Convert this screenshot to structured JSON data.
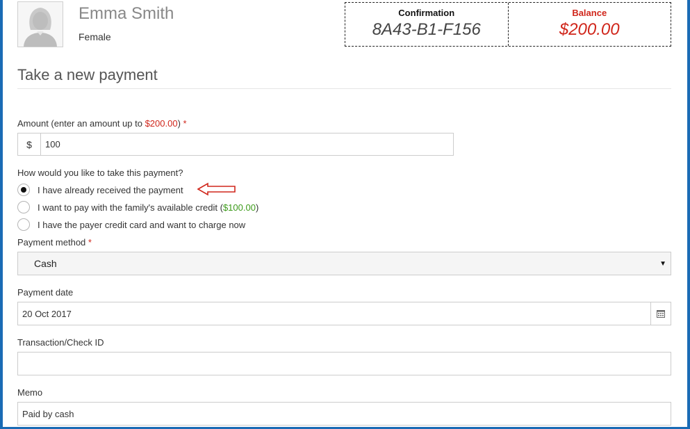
{
  "person": {
    "name": "Emma Smith",
    "gender": "Female",
    "avatar_icon": "female-avatar-icon"
  },
  "summary": {
    "confirmation_label": "Confirmation",
    "confirmation_value": "8A43-B1-F156",
    "balance_label": "Balance",
    "balance_value": "$200.00"
  },
  "section_title": "Take a new payment",
  "amount": {
    "label_prefix": "Amount (enter an amount up to ",
    "label_limit": "$200.00",
    "label_suffix": ")",
    "required_mark": "*",
    "currency_symbol": "$",
    "value": "100"
  },
  "payment_question": "How would you like to take this payment?",
  "payment_options": [
    {
      "label": "I have already received the payment",
      "checked": true
    },
    {
      "label_prefix": "I want to pay with the family's available credit (",
      "credit": "$100.00",
      "label_suffix": ")",
      "checked": false
    },
    {
      "label": "I have the payer credit card and want to charge now",
      "checked": false
    }
  ],
  "payment_method": {
    "label": "Payment method",
    "required_mark": "*",
    "selected": "Cash"
  },
  "payment_date": {
    "label": "Payment date",
    "value": "20 Oct 2017",
    "icon": "calendar-icon"
  },
  "transaction_id": {
    "label": "Transaction/Check ID",
    "value": ""
  },
  "memo": {
    "label": "Memo",
    "value": "Paid by cash"
  },
  "colors": {
    "frame": "#1a6bb5",
    "required": "#d0261b",
    "credit": "#3c9a1a",
    "annotation_arrow": "#d0261b"
  }
}
